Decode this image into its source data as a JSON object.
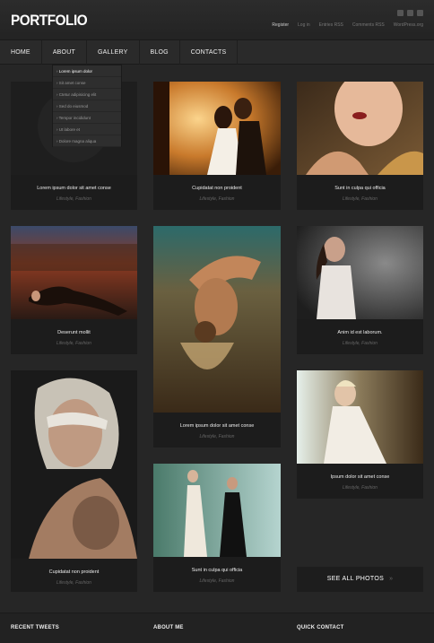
{
  "site": {
    "logo": "PORTFOLIO"
  },
  "toplinks": [
    "Register",
    "Log in",
    "Entries RSS",
    "Comments RSS",
    "WordPress.org"
  ],
  "nav": [
    "HOME",
    "ABOUT",
    "GALLERY",
    "BLOG",
    "CONTACTS"
  ],
  "dropdown": [
    "Lorem ipsum dolor",
    "Sit amet conse",
    "Ctetur adipisicing elit",
    "Sed do eiusmod",
    "Tempor incididunt",
    "Ut labore et",
    "Dolore magna aliqua"
  ],
  "cards": [
    {
      "title": "Lorem ipsum dolor sit amet conse",
      "tags": "Lifestyle, Fashion"
    },
    {
      "title": "Cupidatat non proident",
      "tags": "Lifestyle, Fashion"
    },
    {
      "title": "Sunt in culpa qui officia",
      "tags": "Lifestyle, Fashion"
    },
    {
      "title": "Deserunt mollit",
      "tags": "Lifestyle, Fashion"
    },
    {
      "title": "Lorem ipsum dolor sit amet conse",
      "tags": "Lifestyle, Fashion"
    },
    {
      "title": "Anim id est laborum.",
      "tags": "Lifestyle, Fashion"
    },
    {
      "title": "Cupidatat non proident",
      "tags": "Lifestyle, Fashion"
    },
    {
      "title": "Sunt in culpa qui officia",
      "tags": "Lifestyle, Fashion"
    },
    {
      "title": "Ipsum dolor sit amet conse",
      "tags": "Lifestyle, Fashion"
    }
  ],
  "see_all": "SEE ALL PHOTOS",
  "footer": {
    "tweets": "RECENT TWEETS",
    "about": "ABOUT ME",
    "contact": "QUICK CONTACT"
  }
}
